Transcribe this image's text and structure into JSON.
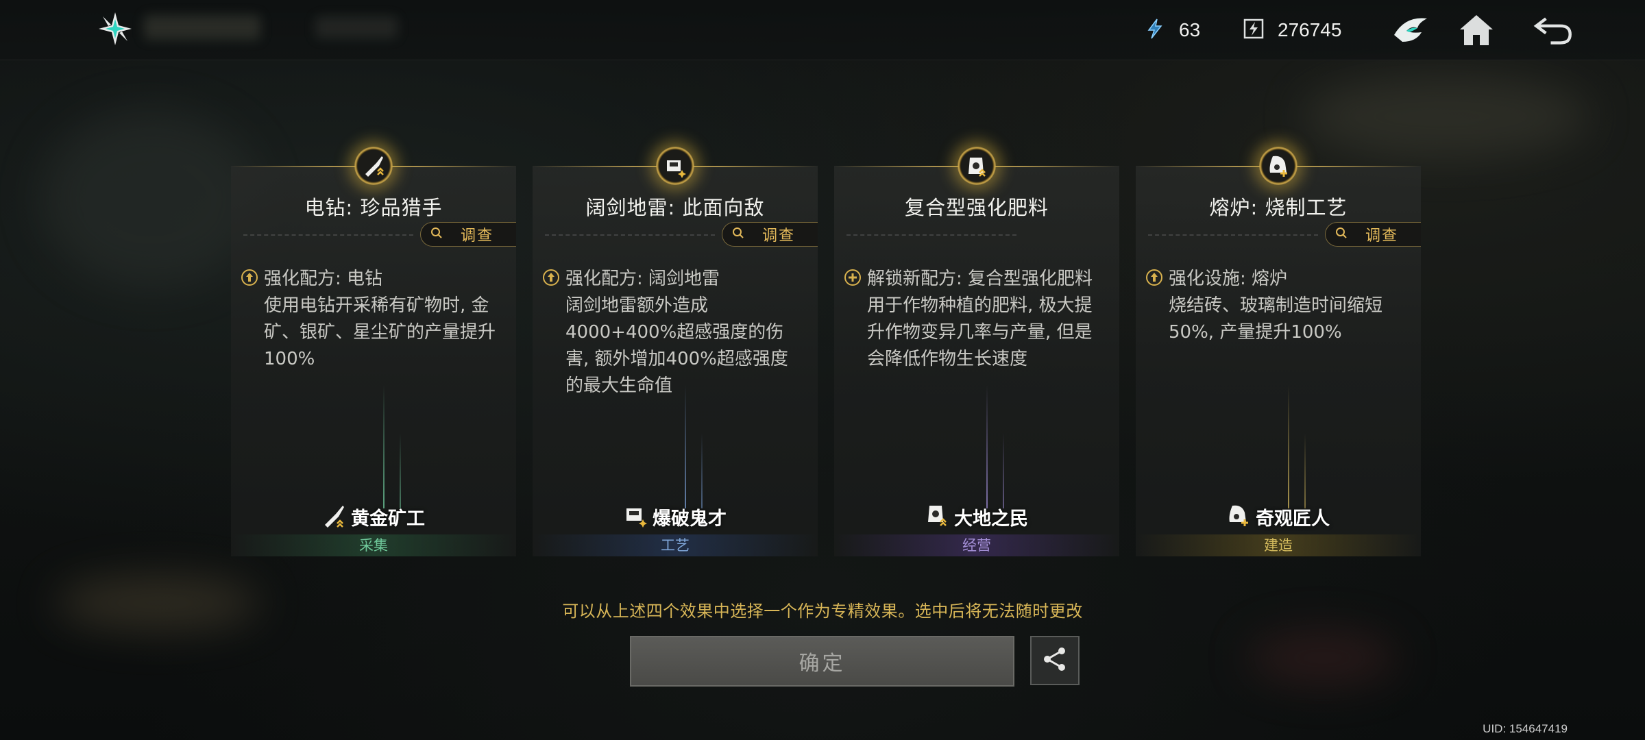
{
  "topbar": {
    "energy": "63",
    "currency": "276745",
    "icons": [
      "logo-icon",
      "energy-icon",
      "currency-icon",
      "mask-icon",
      "home-icon",
      "back-icon"
    ]
  },
  "cards": [
    {
      "emblem_icon": "drill-icon",
      "title": "电钻: 珍品猎手",
      "investigate": "调查",
      "desc_icon": "upgrade-icon",
      "desc": "强化配方: 电钻\n使用电钻开采稀有矿物时, 金矿、银矿、星尘矿的产量提升100%",
      "role_icon": "drill-icon",
      "role": "黄金矿工",
      "category": "采集",
      "color": "#6fc89a"
    },
    {
      "emblem_icon": "mine-icon",
      "title": "阔剑地雷: 此面向敌",
      "investigate": "调查",
      "desc_icon": "upgrade-icon",
      "desc": "强化配方: 阔剑地雷\n阔剑地雷额外造成4000+400%超感强度的伤害, 额外增加400%超感强度的最大生命值",
      "role_icon": "mine-icon",
      "role": "爆破鬼才",
      "category": "工艺",
      "color": "#7fa6d8"
    },
    {
      "emblem_icon": "fertilizer-icon",
      "title": "复合型强化肥料",
      "investigate": "",
      "desc_icon": "unlock-icon",
      "desc": "解锁新配方: 复合型强化肥料\n用于作物种植的肥料, 极大提升作物变异几率与产量, 但是会降低作物生长速度",
      "role_icon": "fertilizer-icon",
      "role": "大地之民",
      "category": "经营",
      "color": "#a590d8"
    },
    {
      "emblem_icon": "furnace-icon",
      "title": "熔炉: 烧制工艺",
      "investigate": "调查",
      "desc_icon": "upgrade-icon",
      "desc": "强化设施: 熔炉\n烧结砖、玻璃制造时间缩短50%, 产量提升100%",
      "role_icon": "furnace-icon",
      "role": "奇观匠人",
      "category": "建造",
      "color": "#d6bd5e"
    }
  ],
  "notice": "可以从上述四个效果中选择一个作为专精效果。选中后将无法随时更改",
  "confirm_label": "确定",
  "uid": "UID: 154647419"
}
